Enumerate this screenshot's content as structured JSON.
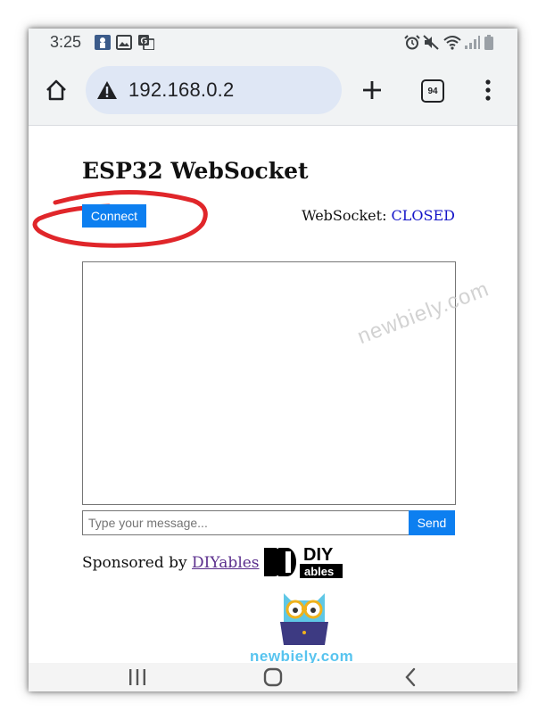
{
  "status_bar": {
    "time": "3:25",
    "left_icons": [
      "notification-app-icon",
      "image-icon",
      "translate-icon"
    ],
    "right_icons": [
      "alarm-icon",
      "mute-icon",
      "wifi-icon",
      "signal-icon",
      "battery-icon"
    ]
  },
  "browser": {
    "url": "192.168.0.2",
    "security_icon": "warning-icon",
    "tab_count": "94",
    "buttons": [
      "home-icon",
      "new-tab-icon",
      "tabs-icon",
      "menu-icon"
    ]
  },
  "page": {
    "title": "ESP32 WebSocket",
    "connect_label": "Connect",
    "ws_label": "WebSocket:",
    "ws_state": "CLOSED",
    "message_log": "",
    "input_placeholder": "Type your message...",
    "send_label": "Send",
    "sponsor_text": "Sponsored by",
    "sponsor_link": "DIYables"
  },
  "branding": {
    "watermark": "newbiely.com",
    "logo_text_top": "DIY",
    "logo_text_bottom": "ables",
    "site": "newbiely.com"
  },
  "nav_bar": {
    "buttons": [
      "recent-apps-icon",
      "home-circle-icon",
      "back-icon"
    ]
  },
  "colors": {
    "accent_button": "#0d7ff0",
    "ws_state": "#1515c8",
    "annotation": "#e0262a",
    "url_bar": "#dfe7f5"
  }
}
